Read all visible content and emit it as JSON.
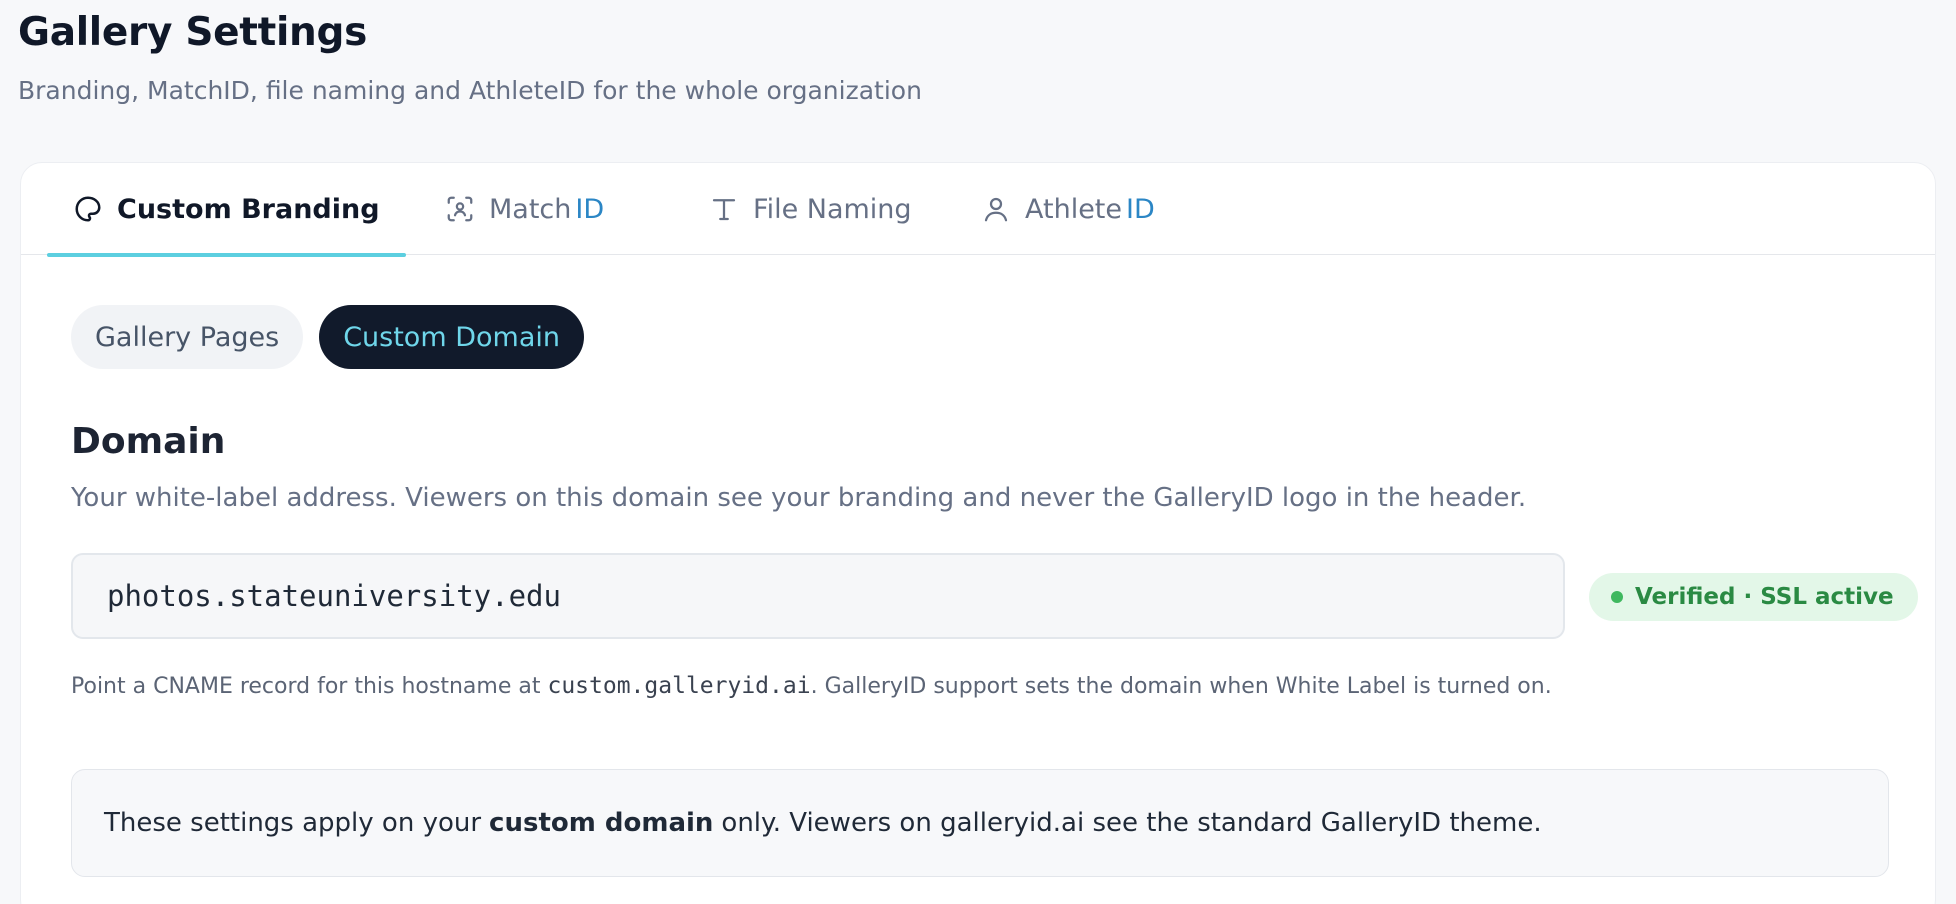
{
  "header": {
    "title": "Gallery Settings",
    "subtitle": "Branding, MatchID, file naming and AthleteID for the whole organization"
  },
  "tabs": [
    {
      "label": "Custom Branding",
      "accent": "",
      "icon": "palette-icon",
      "active": true
    },
    {
      "label": "Match",
      "accent": "ID",
      "icon": "face-scan-icon",
      "active": false
    },
    {
      "label": "File Naming",
      "accent": "",
      "icon": "text-icon",
      "active": false
    },
    {
      "label": "Athlete",
      "accent": "ID",
      "icon": "user-icon",
      "active": false
    }
  ],
  "subtabs": [
    {
      "label": "Gallery Pages",
      "active": false
    },
    {
      "label": "Custom Domain",
      "active": true
    }
  ],
  "domain": {
    "title": "Domain",
    "description": "Your white-label address. Viewers on this domain see your branding and never the GalleryID logo in the header.",
    "value": "photos.stateuniversity.edu",
    "status": "Verified · SSL active",
    "hint_before": "Point a CNAME record for this hostname at ",
    "hint_code": "custom.galleryid.ai",
    "hint_after": ". GalleryID support sets the domain when White Label is turned on."
  },
  "notice": {
    "before": "These settings apply on your",
    "bold": "custom domain",
    "after": "only. Viewers on galleryid.ai see the standard GalleryID theme."
  },
  "colors": {
    "tab_underline": "#5ccfe0",
    "accent_id": "#2b86c5",
    "pill_active_bg": "#111a2b",
    "pill_active_text": "#6fd6ea",
    "verified_bg": "#e3f7e8",
    "verified_text": "#2a8a43"
  }
}
